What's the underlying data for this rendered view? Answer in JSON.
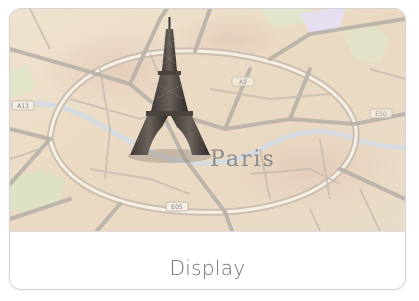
{
  "card": {
    "caption": "Display"
  },
  "map": {
    "city_label": "Paris",
    "road_shields": [
      "A13",
      "E05",
      "A1",
      "E50"
    ]
  }
}
